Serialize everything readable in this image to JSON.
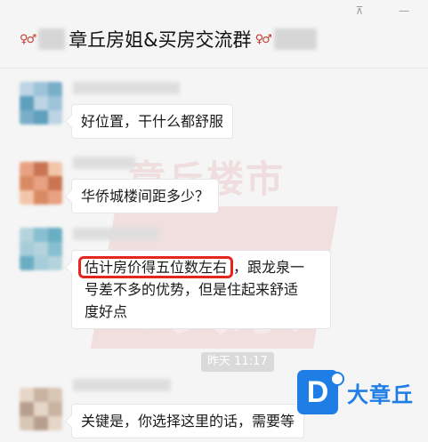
{
  "window": {
    "title_text": "章丘房姐&买房交流群",
    "title_icon": "people-emoji-icon",
    "controls": {
      "pin": "⊼",
      "minimize": "—"
    }
  },
  "watermark": {
    "text": "章丘楼市",
    "big": "頭条"
  },
  "messages": [
    {
      "text": "好位置，干什么都舒服",
      "avatar_colors": [
        "#bcd4e4",
        "#9cc3d9",
        "#7aaec8",
        "#5fa0be"
      ]
    },
    {
      "text": "华侨城楼间距多少？",
      "avatar_colors": [
        "#e8a183",
        "#c97453",
        "#f3c6a9",
        "#d88b63"
      ]
    },
    {
      "highlight": "估计房价得五位数左右",
      "line1_rest": "，跟龙泉一",
      "line2": "号差不多的优势，但是住起来舒适",
      "line3": "度好点",
      "avatar_colors": [
        "#b4d3dc",
        "#88bfd0",
        "#6aaec4",
        "#a6cdd9"
      ]
    },
    {
      "text": "关键是，你选择这里的话，需要等",
      "avatar_colors": [
        "#e6d6c8",
        "#c9b3a2",
        "#d8c6b6",
        "#b89f8d"
      ]
    }
  ],
  "timestamp": "昨天 11:17",
  "brand": {
    "logo_letter": "D",
    "name": "大章丘",
    "color": "#1f7ee6"
  },
  "colors": {
    "highlight_border": "#e4261e",
    "background": "#f5f5f5"
  }
}
